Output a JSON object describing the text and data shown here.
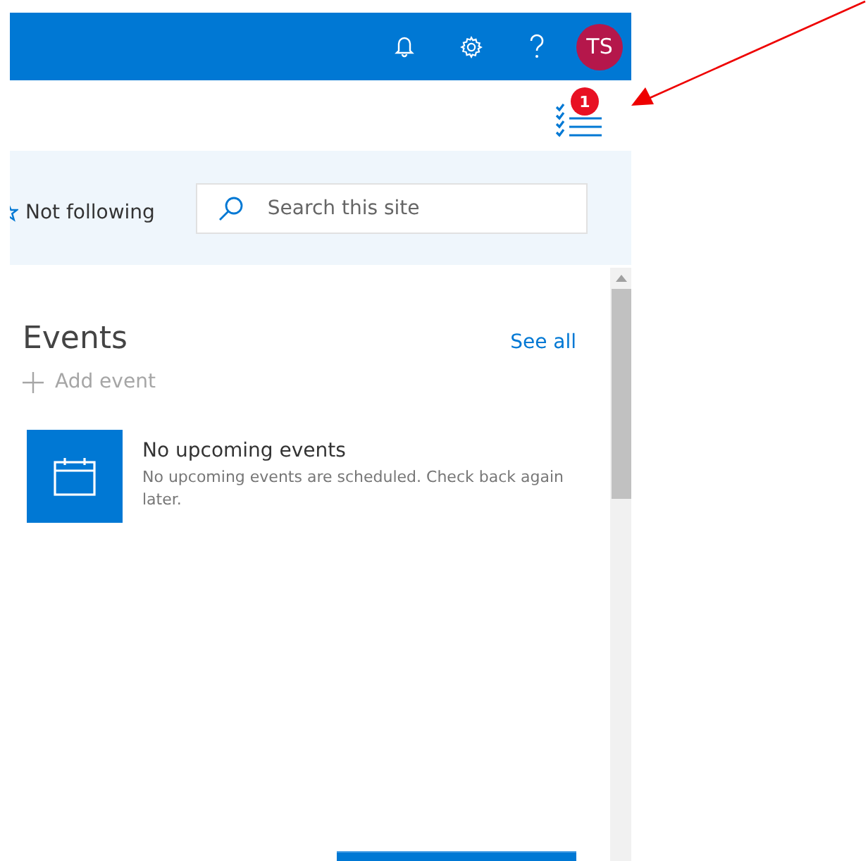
{
  "header": {
    "avatar": {
      "initials": "TS"
    }
  },
  "toolbar": {
    "badge": "1"
  },
  "follow": {
    "label": "Not following"
  },
  "search": {
    "placeholder": "Search this site"
  },
  "events": {
    "title": "Events",
    "see_all": "See all",
    "add": "Add event",
    "empty_title": "No upcoming events",
    "empty_text": "No upcoming events are scheduled. Check back again later."
  }
}
